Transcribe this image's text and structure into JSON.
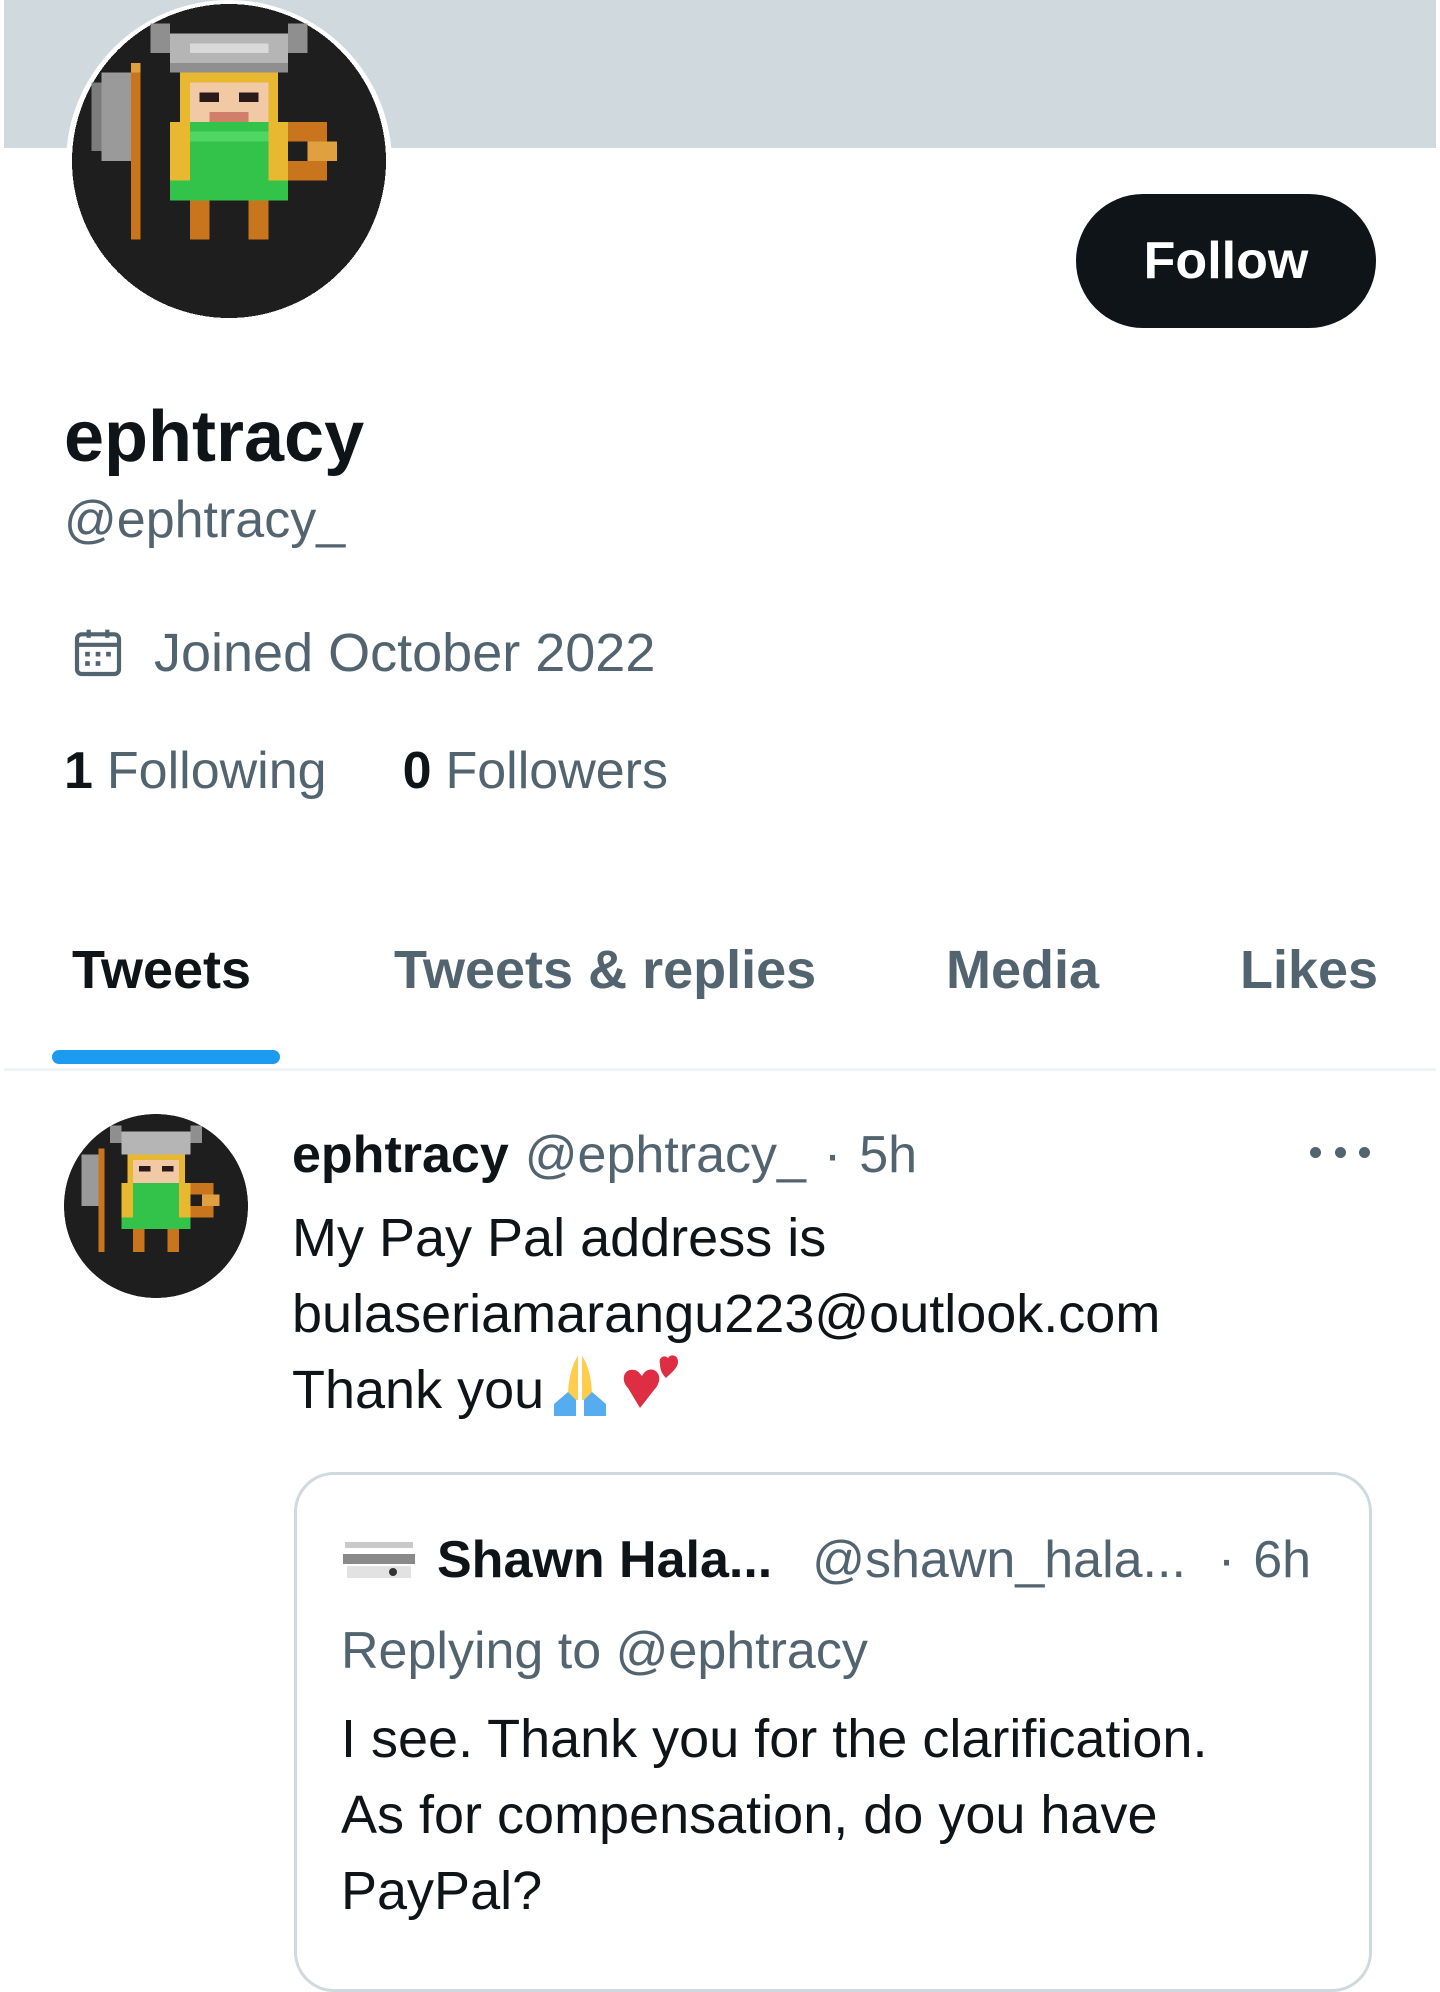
{
  "profile": {
    "display_name": "ephtracy",
    "handle": "@ephtracy_",
    "joined": "Joined October 2022",
    "following_count": "1",
    "following_label": "Following",
    "followers_count": "0",
    "followers_label": "Followers",
    "follow_label": "Follow",
    "banner_color": "#cfd9de"
  },
  "tabs": [
    {
      "label": "Tweets",
      "active": true
    },
    {
      "label": "Tweets & replies",
      "active": false
    },
    {
      "label": "Media",
      "active": false
    },
    {
      "label": "Likes",
      "active": false
    }
  ],
  "tweet": {
    "author": "ephtracy",
    "handle": "@ephtracy_",
    "dot": "·",
    "time": "5h",
    "lines": [
      "My Pay Pal address is",
      "bulaseriamarangu223@outlook.com",
      "Thank you"
    ],
    "emojis": [
      "folded-hands-emoji",
      "two-hearts-emoji"
    ],
    "quoted": {
      "author": "Shawn Hala...",
      "handle": "@shawn_hala...",
      "dot": "·",
      "time": "6h",
      "replying_prefix": "Replying to",
      "replying_handle": "@ephtracy",
      "lines": [
        "I see. Thank you for the clarification.",
        "As for compensation, do you have",
        "PayPal?"
      ]
    }
  },
  "colors": {
    "accent": "#1d9bf0",
    "text_primary": "#0f1419",
    "text_secondary": "#536471",
    "border": "#cfd9de",
    "button_dark": "#0f1419"
  }
}
